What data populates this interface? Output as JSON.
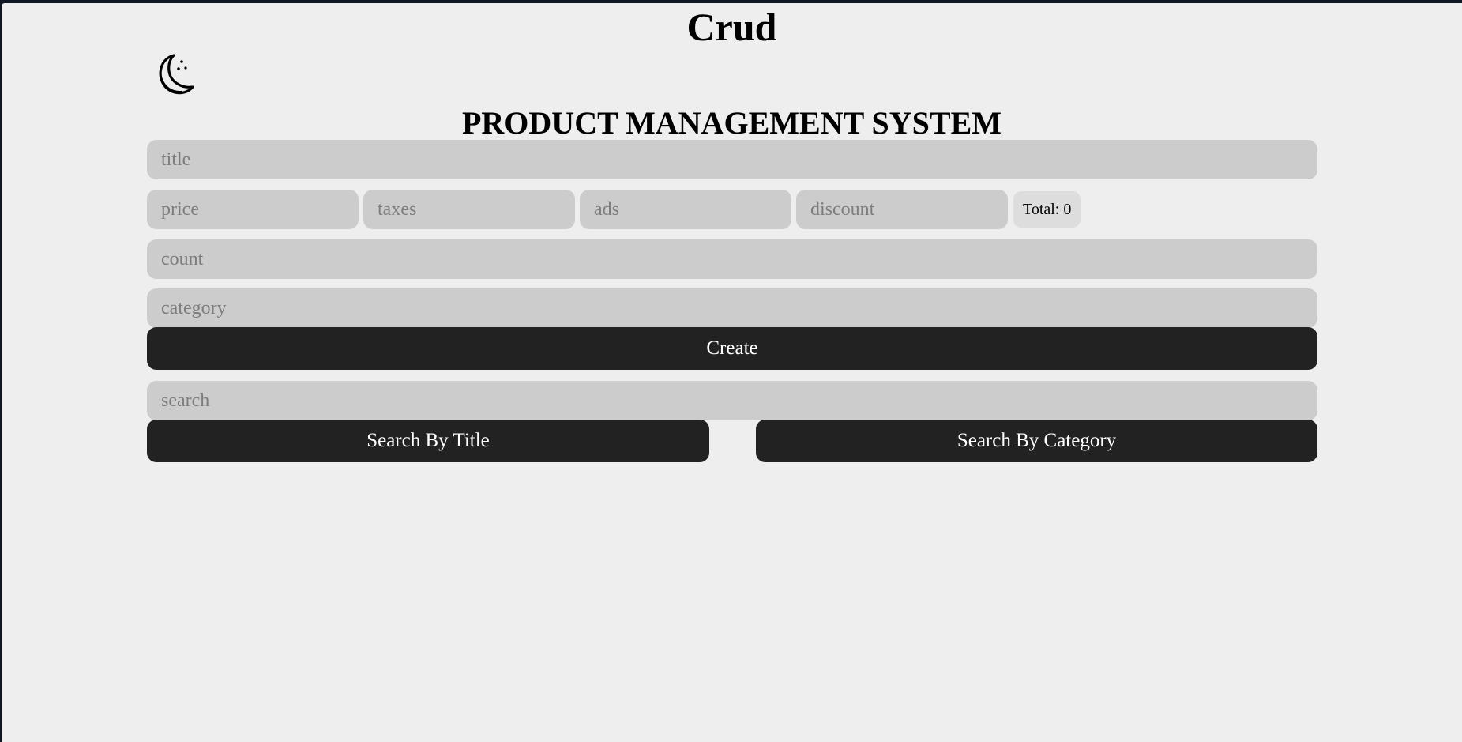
{
  "app": {
    "title": "Crud"
  },
  "theme_toggle": {
    "icon": "moon-icon"
  },
  "heading": "PRODUCT MANAGEMENT SYSTEM",
  "form": {
    "title_placeholder": "title",
    "price_placeholder": "price",
    "taxes_placeholder": "taxes",
    "ads_placeholder": "ads",
    "discount_placeholder": "discount",
    "total_label": "Total: 0",
    "count_placeholder": "count",
    "category_placeholder": "category",
    "create_label": "Create"
  },
  "search": {
    "placeholder": "search",
    "by_title_label": "Search By Title",
    "by_category_label": "Search By Category"
  },
  "colors": {
    "background": "#eeeeee",
    "input": "#cccccc",
    "button": "#222222"
  }
}
